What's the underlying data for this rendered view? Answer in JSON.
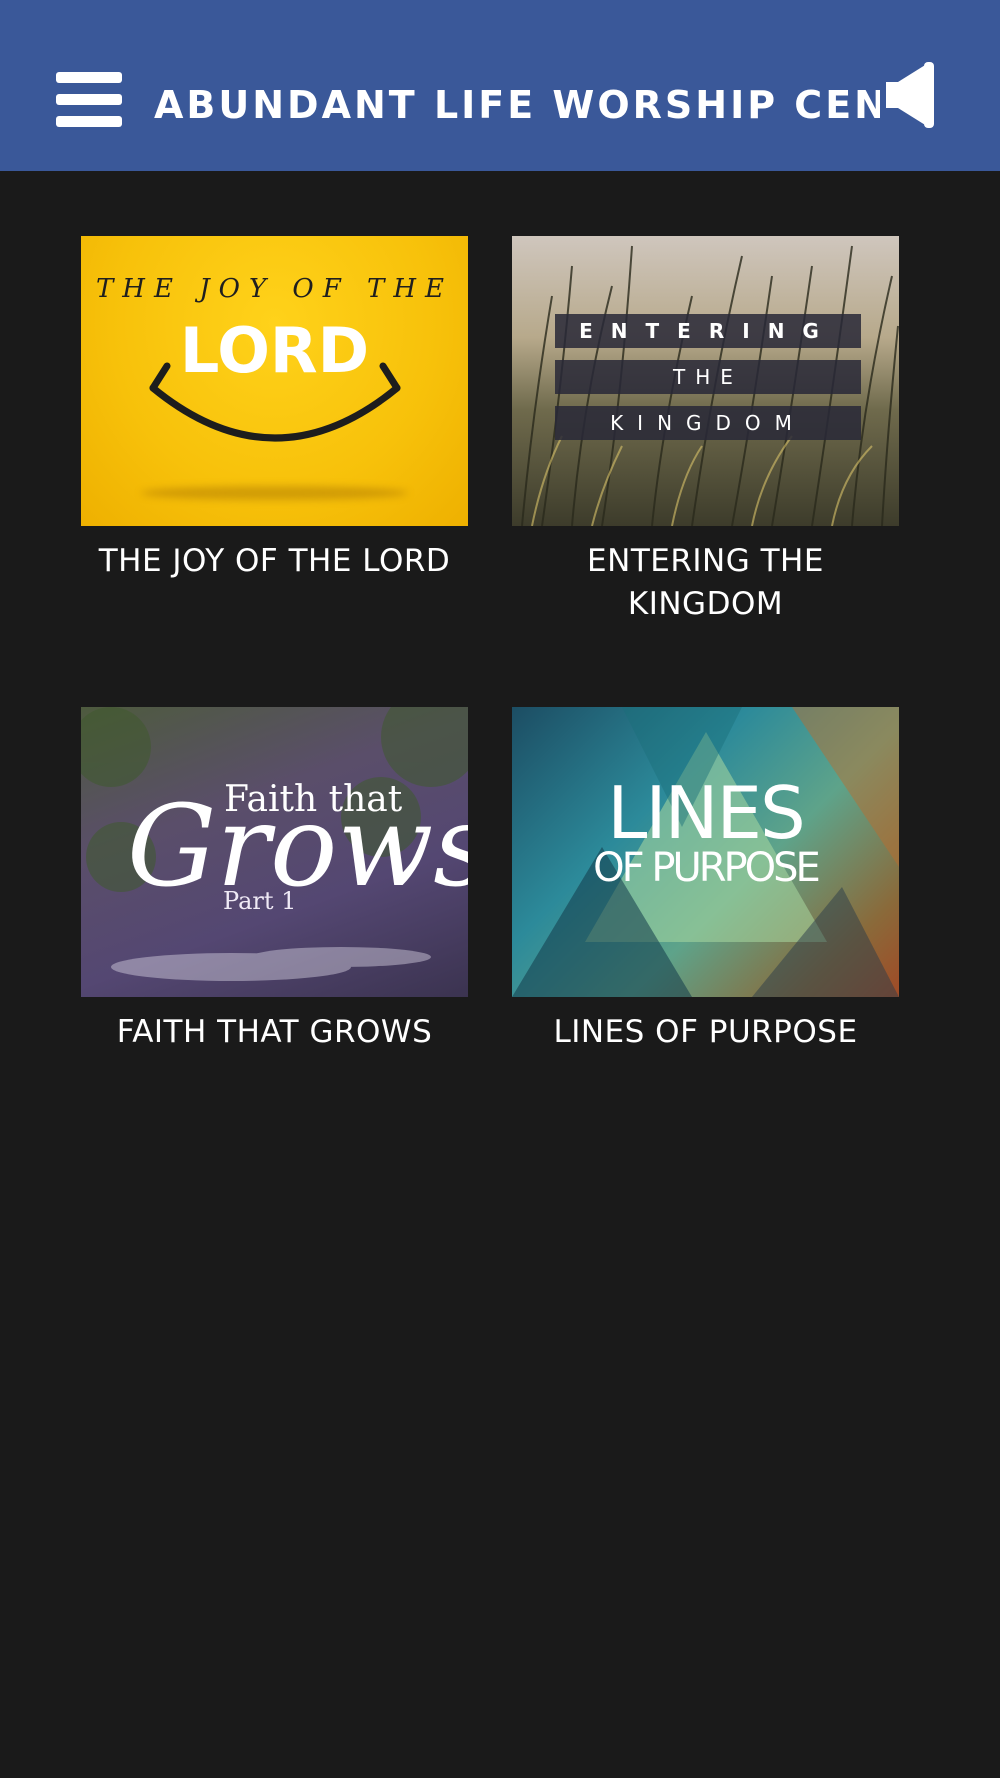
{
  "header": {
    "title": "ABUNDANT LIFE WORSHIP CENTER",
    "menu_icon": "hamburger-menu-icon",
    "speaker_icon": "speaker-icon",
    "background_color": "#3a5899"
  },
  "page": {
    "background_color": "#1a1a1a"
  },
  "series": [
    {
      "title": "THE JOY OF THE LORD",
      "art": {
        "line1": "THE JOY OF THE",
        "line2": "LORD"
      }
    },
    {
      "title": "ENTERING THE KINGDOM",
      "art": {
        "line1": "ENTERING",
        "line2": "THE",
        "line3": "KINGDOM"
      }
    },
    {
      "title": "FAITH THAT GROWS",
      "art": {
        "line1": "Faith that",
        "line2": "Grows",
        "line3": "Part 1"
      }
    },
    {
      "title": "LINES OF PURPOSE",
      "art": {
        "line1": "LINES",
        "line2": "OF PURPOSE"
      }
    }
  ]
}
